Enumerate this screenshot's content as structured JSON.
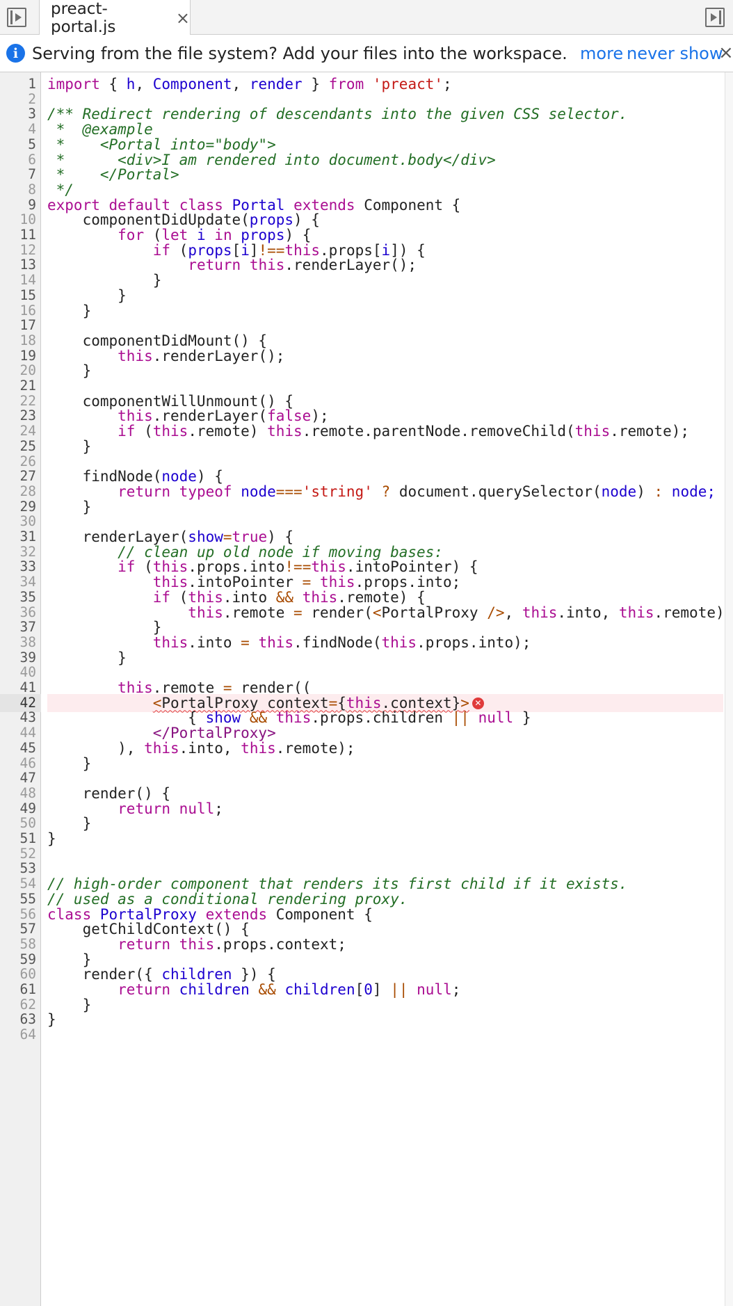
{
  "tabbar": {
    "tab_label": "preact-portal.js",
    "close_glyph": "×",
    "left_icon": "toggle-navigator-icon",
    "right_icon": "toggle-debugger-icon"
  },
  "infobar": {
    "icon": "info-icon",
    "icon_glyph": "i",
    "message": "Serving from the file system? Add your files into the workspace.",
    "more_label": "more",
    "never_show_label": "never show",
    "close_glyph": "×"
  },
  "editor": {
    "error_line": 42,
    "error_glyph": "✕",
    "lines": [
      [
        [
          "kw",
          "import"
        ],
        [
          "pl",
          " { "
        ],
        [
          "vr",
          "h"
        ],
        [
          "pl",
          ", "
        ],
        [
          "vr",
          "Component"
        ],
        [
          "pl",
          ", "
        ],
        [
          "vr",
          "render"
        ],
        [
          "pl",
          " } "
        ],
        [
          "kw",
          "from"
        ],
        [
          "pl",
          " "
        ],
        [
          "st",
          "'preact'"
        ],
        [
          "pl",
          ";"
        ]
      ],
      [],
      [
        [
          "cm",
          "/** Redirect rendering of descendants into the given CSS selector."
        ]
      ],
      [
        [
          "cm",
          " *  @example"
        ]
      ],
      [
        [
          "cm",
          " *    <Portal into=\"body\">"
        ]
      ],
      [
        [
          "cm",
          " *      <div>I am rendered into document.body</div>"
        ]
      ],
      [
        [
          "cm",
          " *    </Portal>"
        ]
      ],
      [
        [
          "cm",
          " */"
        ]
      ],
      [
        [
          "kw",
          "export"
        ],
        [
          "pl",
          " "
        ],
        [
          "kw",
          "default"
        ],
        [
          "pl",
          " "
        ],
        [
          "kw",
          "class"
        ],
        [
          "pl",
          " "
        ],
        [
          "vr",
          "Portal"
        ],
        [
          "pl",
          " "
        ],
        [
          "kw",
          "extends"
        ],
        [
          "pl",
          " Component {"
        ]
      ],
      [
        [
          "pl",
          "    componentDidUpdate("
        ],
        [
          "vr",
          "props"
        ],
        [
          "pl",
          ") {"
        ]
      ],
      [
        [
          "pl",
          "        "
        ],
        [
          "kw",
          "for"
        ],
        [
          "pl",
          " ("
        ],
        [
          "kw",
          "let"
        ],
        [
          "pl",
          " "
        ],
        [
          "vr",
          "i"
        ],
        [
          "pl",
          " "
        ],
        [
          "kw",
          "in"
        ],
        [
          "pl",
          " "
        ],
        [
          "vr",
          "props"
        ],
        [
          "pl",
          ") {"
        ]
      ],
      [
        [
          "pl",
          "            "
        ],
        [
          "kw",
          "if"
        ],
        [
          "pl",
          " ("
        ],
        [
          "vr",
          "props"
        ],
        [
          "pl",
          "["
        ],
        [
          "vr",
          "i"
        ],
        [
          "pl",
          "]"
        ],
        [
          "op",
          "!=="
        ],
        [
          "kw",
          "this"
        ],
        [
          "pl",
          ".props["
        ],
        [
          "vr",
          "i"
        ],
        [
          "pl",
          "]) {"
        ]
      ],
      [
        [
          "pl",
          "                "
        ],
        [
          "kw",
          "return"
        ],
        [
          "pl",
          " "
        ],
        [
          "kw",
          "this"
        ],
        [
          "pl",
          ".renderLayer();"
        ]
      ],
      [
        [
          "pl",
          "            }"
        ]
      ],
      [
        [
          "pl",
          "        }"
        ]
      ],
      [
        [
          "pl",
          "    }"
        ]
      ],
      [],
      [
        [
          "pl",
          "    componentDidMount() {"
        ]
      ],
      [
        [
          "pl",
          "        "
        ],
        [
          "kw",
          "this"
        ],
        [
          "pl",
          ".renderLayer();"
        ]
      ],
      [
        [
          "pl",
          "    }"
        ]
      ],
      [],
      [
        [
          "pl",
          "    componentWillUnmount() {"
        ]
      ],
      [
        [
          "pl",
          "        "
        ],
        [
          "kw",
          "this"
        ],
        [
          "pl",
          ".renderLayer("
        ],
        [
          "kw",
          "false"
        ],
        [
          "pl",
          ");"
        ]
      ],
      [
        [
          "pl",
          "        "
        ],
        [
          "kw",
          "if"
        ],
        [
          "pl",
          " ("
        ],
        [
          "kw",
          "this"
        ],
        [
          "pl",
          ".remote) "
        ],
        [
          "kw",
          "this"
        ],
        [
          "pl",
          ".remote.parentNode.removeChild("
        ],
        [
          "kw",
          "this"
        ],
        [
          "pl",
          ".remote);"
        ]
      ],
      [
        [
          "pl",
          "    }"
        ]
      ],
      [],
      [
        [
          "pl",
          "    findNode("
        ],
        [
          "vr",
          "node"
        ],
        [
          "pl",
          ") {"
        ]
      ],
      [
        [
          "pl",
          "        "
        ],
        [
          "kw",
          "return"
        ],
        [
          "pl",
          " "
        ],
        [
          "kw",
          "typeof"
        ],
        [
          "pl",
          " "
        ],
        [
          "vr",
          "node"
        ],
        [
          "op",
          "==="
        ],
        [
          "st",
          "'string'"
        ],
        [
          "pl",
          " "
        ],
        [
          "op",
          "?"
        ],
        [
          "pl",
          " document.querySelector("
        ],
        [
          "vr",
          "node"
        ],
        [
          "pl",
          ") "
        ],
        [
          "op",
          ":"
        ],
        [
          "pl",
          " "
        ],
        [
          "vr",
          "node;"
        ]
      ],
      [
        [
          "pl",
          "    }"
        ]
      ],
      [],
      [
        [
          "pl",
          "    renderLayer("
        ],
        [
          "vr",
          "show"
        ],
        [
          "op",
          "="
        ],
        [
          "kw",
          "true"
        ],
        [
          "pl",
          ") {"
        ]
      ],
      [
        [
          "pl",
          "        "
        ],
        [
          "cm",
          "// clean up old node if moving bases:"
        ]
      ],
      [
        [
          "pl",
          "        "
        ],
        [
          "kw",
          "if"
        ],
        [
          "pl",
          " ("
        ],
        [
          "kw",
          "this"
        ],
        [
          "pl",
          ".props.into"
        ],
        [
          "op",
          "!=="
        ],
        [
          "kw",
          "this"
        ],
        [
          "pl",
          ".intoPointer) {"
        ]
      ],
      [
        [
          "pl",
          "            "
        ],
        [
          "kw",
          "this"
        ],
        [
          "pl",
          ".intoPointer "
        ],
        [
          "op",
          "="
        ],
        [
          "pl",
          " "
        ],
        [
          "kw",
          "this"
        ],
        [
          "pl",
          ".props.into;"
        ]
      ],
      [
        [
          "pl",
          "            "
        ],
        [
          "kw",
          "if"
        ],
        [
          "pl",
          " ("
        ],
        [
          "kw",
          "this"
        ],
        [
          "pl",
          ".into "
        ],
        [
          "op",
          "&&"
        ],
        [
          "pl",
          " "
        ],
        [
          "kw",
          "this"
        ],
        [
          "pl",
          ".remote) {"
        ]
      ],
      [
        [
          "pl",
          "                "
        ],
        [
          "kw",
          "this"
        ],
        [
          "pl",
          ".remote "
        ],
        [
          "op",
          "="
        ],
        [
          "pl",
          " render("
        ],
        [
          "op",
          "<"
        ],
        [
          "pl",
          "PortalProxy "
        ],
        [
          "op",
          "/>"
        ],
        [
          "pl",
          ", "
        ],
        [
          "kw",
          "this"
        ],
        [
          "pl",
          ".into, "
        ],
        [
          "kw",
          "this"
        ],
        [
          "pl",
          ".remote);"
        ]
      ],
      [
        [
          "pl",
          "            }"
        ]
      ],
      [
        [
          "pl",
          "            "
        ],
        [
          "kw",
          "this"
        ],
        [
          "pl",
          ".into "
        ],
        [
          "op",
          "="
        ],
        [
          "pl",
          " "
        ],
        [
          "kw",
          "this"
        ],
        [
          "pl",
          ".findNode("
        ],
        [
          "kw",
          "this"
        ],
        [
          "pl",
          ".props.into);"
        ]
      ],
      [
        [
          "pl",
          "        }"
        ]
      ],
      [],
      [
        [
          "pl",
          "        "
        ],
        [
          "kw",
          "this"
        ],
        [
          "pl",
          ".remote "
        ],
        [
          "op",
          "="
        ],
        [
          "pl",
          " render(("
        ]
      ],
      [
        [
          "pl",
          "            "
        ],
        [
          "op",
          "<"
        ],
        [
          "pl",
          "PortalProxy context"
        ],
        [
          "op",
          "="
        ],
        [
          "pl",
          "{"
        ],
        [
          "kw",
          "this"
        ],
        [
          "pl",
          ".context}"
        ],
        [
          "op",
          ">"
        ]
      ],
      [
        [
          "pl",
          "                { "
        ],
        [
          "vr",
          "show"
        ],
        [
          "pl",
          " "
        ],
        [
          "op",
          "&&"
        ],
        [
          "pl",
          " "
        ],
        [
          "kw",
          "this"
        ],
        [
          "pl",
          ".props.children "
        ],
        [
          "op",
          "||"
        ],
        [
          "pl",
          " "
        ],
        [
          "kw",
          "null"
        ],
        [
          "pl",
          " }"
        ]
      ],
      [
        [
          "pl",
          "            "
        ],
        [
          "tg",
          "</PortalProxy>"
        ]
      ],
      [
        [
          "pl",
          "        ), "
        ],
        [
          "kw",
          "this"
        ],
        [
          "pl",
          ".into, "
        ],
        [
          "kw",
          "this"
        ],
        [
          "pl",
          ".remote);"
        ]
      ],
      [
        [
          "pl",
          "    }"
        ]
      ],
      [],
      [
        [
          "pl",
          "    render() {"
        ]
      ],
      [
        [
          "pl",
          "        "
        ],
        [
          "kw",
          "return"
        ],
        [
          "pl",
          " "
        ],
        [
          "kw",
          "null"
        ],
        [
          "pl",
          ";"
        ]
      ],
      [
        [
          "pl",
          "    }"
        ]
      ],
      [
        [
          "pl",
          "}"
        ]
      ],
      [],
      [],
      [
        [
          "cm",
          "// high-order component that renders its first child if it exists."
        ]
      ],
      [
        [
          "cm",
          "// used as a conditional rendering proxy."
        ]
      ],
      [
        [
          "kw",
          "class"
        ],
        [
          "pl",
          " "
        ],
        [
          "vr",
          "PortalProxy"
        ],
        [
          "pl",
          " "
        ],
        [
          "kw",
          "extends"
        ],
        [
          "pl",
          " Component {"
        ]
      ],
      [
        [
          "pl",
          "    getChildContext() {"
        ]
      ],
      [
        [
          "pl",
          "        "
        ],
        [
          "kw",
          "return"
        ],
        [
          "pl",
          " "
        ],
        [
          "kw",
          "this"
        ],
        [
          "pl",
          ".props.context;"
        ]
      ],
      [
        [
          "pl",
          "    }"
        ]
      ],
      [
        [
          "pl",
          "    render({ "
        ],
        [
          "vr",
          "children"
        ],
        [
          "pl",
          " }) {"
        ]
      ],
      [
        [
          "pl",
          "        "
        ],
        [
          "kw",
          "return"
        ],
        [
          "pl",
          " "
        ],
        [
          "vr",
          "children"
        ],
        [
          "pl",
          " "
        ],
        [
          "op",
          "&&"
        ],
        [
          "pl",
          " "
        ],
        [
          "vr",
          "children"
        ],
        [
          "pl",
          "["
        ],
        [
          "vr",
          "0"
        ],
        [
          "pl",
          "] "
        ],
        [
          "op",
          "||"
        ],
        [
          "pl",
          " "
        ],
        [
          "kw",
          "null"
        ],
        [
          "pl",
          ";"
        ]
      ],
      [
        [
          "pl",
          "    }"
        ]
      ],
      [
        [
          "pl",
          "}"
        ]
      ],
      []
    ]
  }
}
